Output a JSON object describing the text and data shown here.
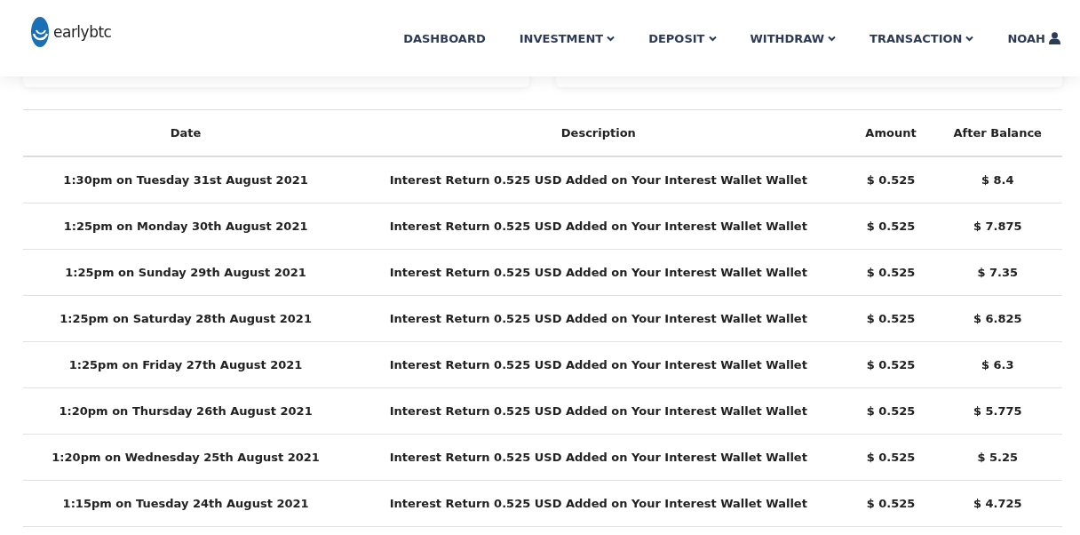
{
  "header": {
    "logo_text": "earlybtc",
    "nav": [
      {
        "label": "DASHBOARD",
        "dropdown": false
      },
      {
        "label": "INVESTMENT",
        "dropdown": true
      },
      {
        "label": "DEPOSIT",
        "dropdown": true
      },
      {
        "label": "WITHDRAW",
        "dropdown": true
      },
      {
        "label": "TRANSACTION",
        "dropdown": true
      }
    ],
    "user": {
      "label": "NOAH"
    }
  },
  "table": {
    "columns": [
      "Date",
      "Description",
      "Amount",
      "After Balance"
    ],
    "rows": [
      [
        "1:30pm on Tuesday 31st August 2021",
        "Interest Return 0.525 USD Added on Your Interest Wallet Wallet",
        "$ 0.525",
        "$ 8.4"
      ],
      [
        "1:25pm on Monday 30th August 2021",
        "Interest Return 0.525 USD Added on Your Interest Wallet Wallet",
        "$ 0.525",
        "$ 7.875"
      ],
      [
        "1:25pm on Sunday 29th August 2021",
        "Interest Return 0.525 USD Added on Your Interest Wallet Wallet",
        "$ 0.525",
        "$ 7.35"
      ],
      [
        "1:25pm on Saturday 28th August 2021",
        "Interest Return 0.525 USD Added on Your Interest Wallet Wallet",
        "$ 0.525",
        "$ 6.825"
      ],
      [
        "1:25pm on Friday 27th August 2021",
        "Interest Return 0.525 USD Added on Your Interest Wallet Wallet",
        "$ 0.525",
        "$ 6.3"
      ],
      [
        "1:20pm on Thursday 26th August 2021",
        "Interest Return 0.525 USD Added on Your Interest Wallet Wallet",
        "$ 0.525",
        "$ 5.775"
      ],
      [
        "1:20pm on Wednesday 25th August 2021",
        "Interest Return 0.525 USD Added on Your Interest Wallet Wallet",
        "$ 0.525",
        "$ 5.25"
      ],
      [
        "1:15pm on Tuesday 24th August 2021",
        "Interest Return 0.525 USD Added on Your Interest Wallet Wallet",
        "$ 0.525",
        "$ 4.725"
      ]
    ]
  }
}
